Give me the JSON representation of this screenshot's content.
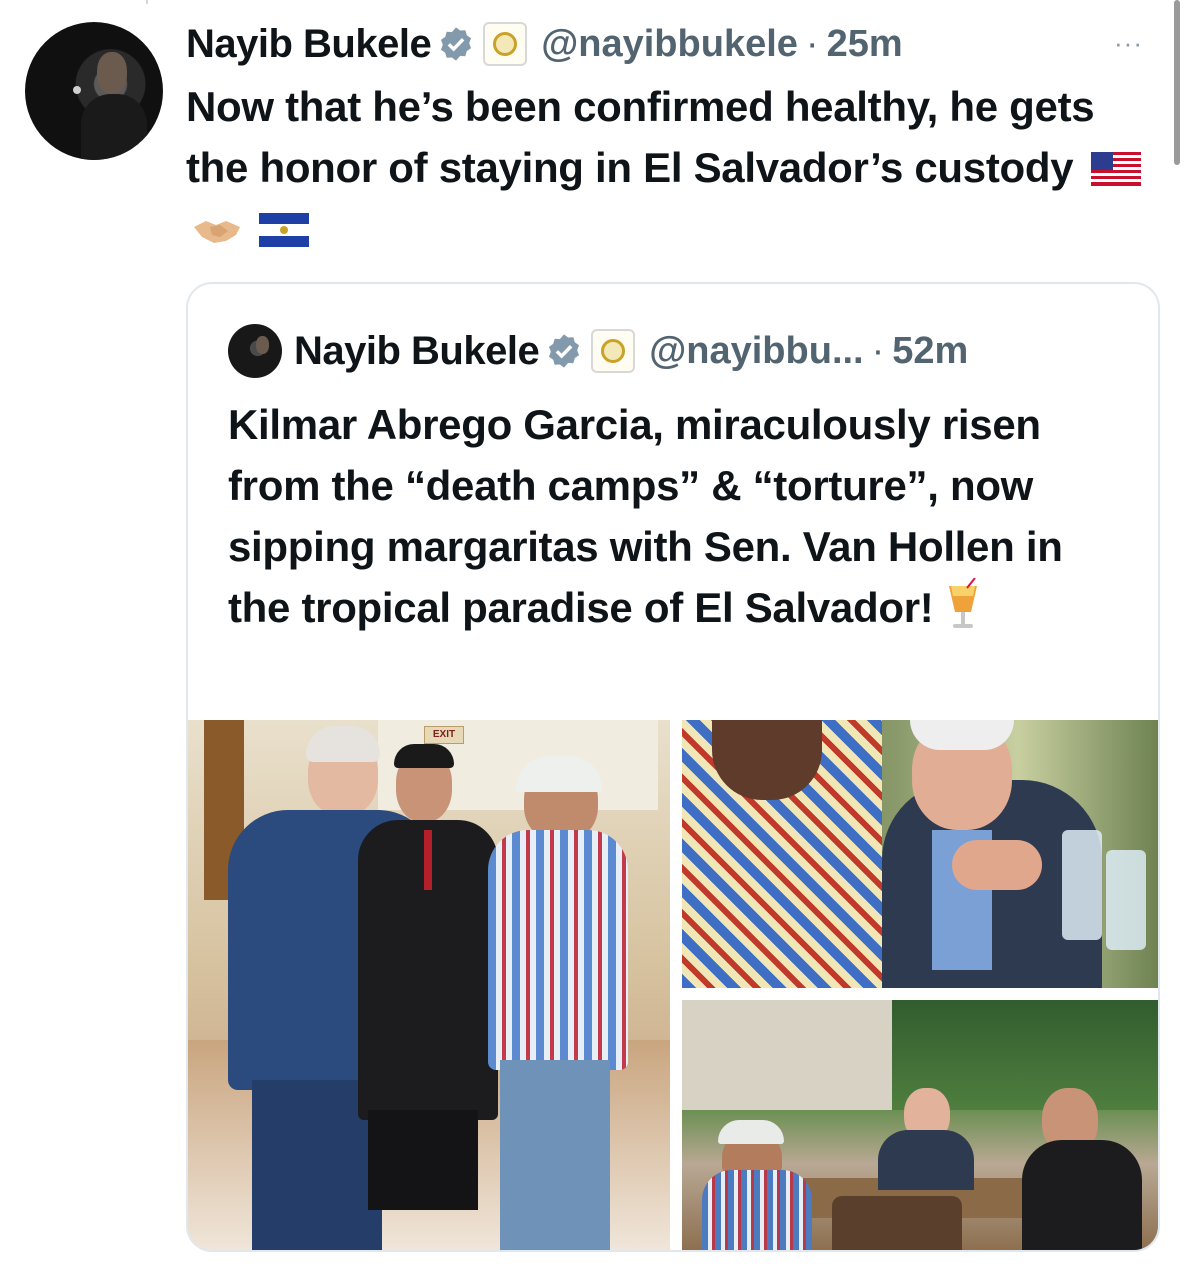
{
  "tweet": {
    "author_name": "Nayib Bukele",
    "handle": "@nayibbukele",
    "separator": "·",
    "time": "25m",
    "more_label": "···",
    "text": "Now that he’s been confirmed healthy, he gets the honor of staying in El Salvador’s custody",
    "emoji": [
      "us-flag",
      "handshake",
      "el-salvador-flag"
    ]
  },
  "quoted_tweet": {
    "author_name": "Nayib Bukele",
    "handle": "@nayibbu...",
    "separator": "·",
    "time": "52m",
    "text": "Kilmar Abrego Garcia, miraculously risen from the “death camps” & “torture”, now sipping margaritas with Sen. Van Hollen in the tropical paradise of El Salvador! ",
    "emoji": [
      "tropical-drink"
    ],
    "images": [
      {
        "icon": "photo-handshake-lobby"
      },
      {
        "icon": "photo-closeup-table"
      },
      {
        "icon": "photo-outdoor-restaurant"
      }
    ],
    "exit_sign": "EXIT"
  },
  "colors": {
    "text": "#0f1419",
    "secondary": "#536471",
    "verified": "#829aab",
    "border": "#e1e8ed"
  }
}
